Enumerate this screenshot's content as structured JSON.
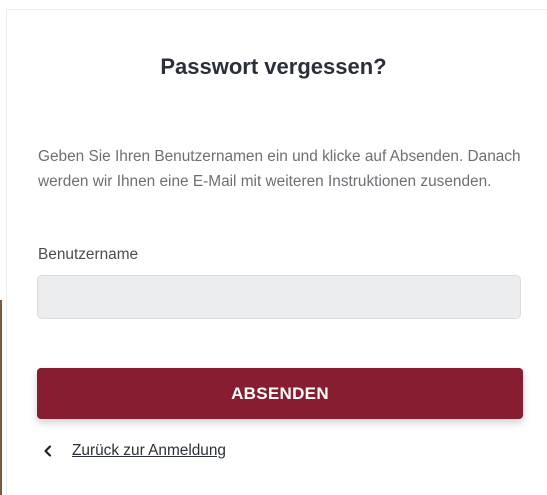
{
  "title": "Passwort vergessen?",
  "intro": "Geben Sie Ihren Benutzernamen ein und klicke auf Absenden. Danach werden wir Ihnen eine E-Mail mit weiteren Instruktionen zusenden.",
  "form": {
    "username_label": "Benutzername",
    "username_value": "",
    "username_placeholder": ""
  },
  "submit_label": "ABSENDEN",
  "back": {
    "icon": "chevron-left-icon",
    "label": "Zurück zur Anmeldung"
  },
  "colors": {
    "accent": "#861d31",
    "title": "#2b2f3a",
    "text": "#6c6f74",
    "input_bg": "#ebedef"
  }
}
